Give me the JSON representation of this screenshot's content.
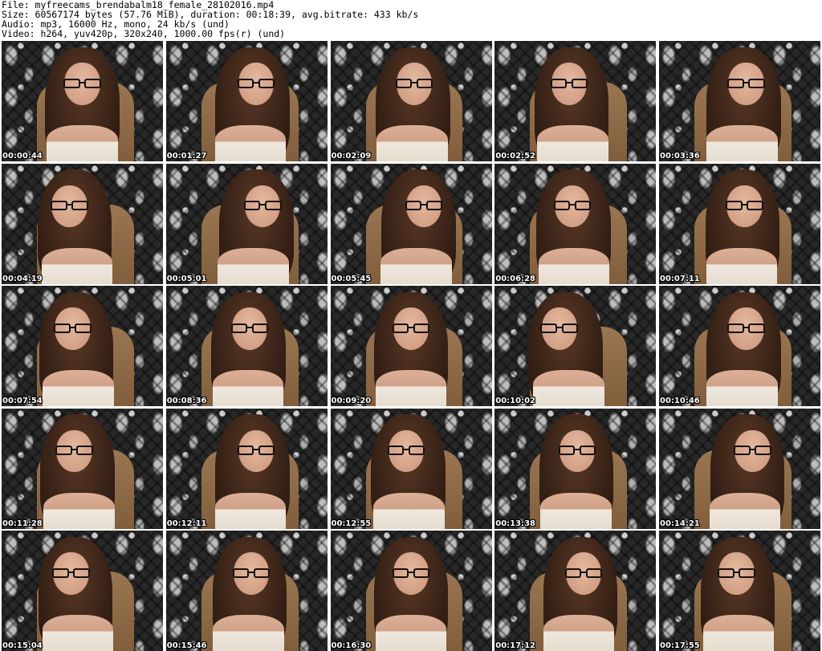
{
  "header": {
    "file": "File: myfreecams_brendabalm18_female_28102016.mp4",
    "size": "Size: 60567174 bytes (57.76 MiB), duration: 00:18:39, avg.bitrate: 433 kb/s",
    "audio": "Audio: mp3, 16000 Hz, mono, 24 kb/s (und)",
    "video": "Video: h264, yuv420p, 320x240, 1000.00 fps(r) (und)"
  },
  "thumbnails": [
    {
      "timestamp": "00:00:44"
    },
    {
      "timestamp": "00:01:27"
    },
    {
      "timestamp": "00:02:09"
    },
    {
      "timestamp": "00:02:52"
    },
    {
      "timestamp": "00:03:36"
    },
    {
      "timestamp": "00:04:19"
    },
    {
      "timestamp": "00:05:01"
    },
    {
      "timestamp": "00:05:45"
    },
    {
      "timestamp": "00:06:28"
    },
    {
      "timestamp": "00:07:11"
    },
    {
      "timestamp": "00:07:54"
    },
    {
      "timestamp": "00:08:36"
    },
    {
      "timestamp": "00:09:20"
    },
    {
      "timestamp": "00:10:02"
    },
    {
      "timestamp": "00:10:46"
    },
    {
      "timestamp": "00:11:28"
    },
    {
      "timestamp": "00:12:11"
    },
    {
      "timestamp": "00:12:55"
    },
    {
      "timestamp": "00:13:38"
    },
    {
      "timestamp": "00:14:21"
    },
    {
      "timestamp": "00:15:04"
    },
    {
      "timestamp": "00:15:46"
    },
    {
      "timestamp": "00:16:30"
    },
    {
      "timestamp": "00:17:12"
    },
    {
      "timestamp": "00:17:55"
    }
  ]
}
